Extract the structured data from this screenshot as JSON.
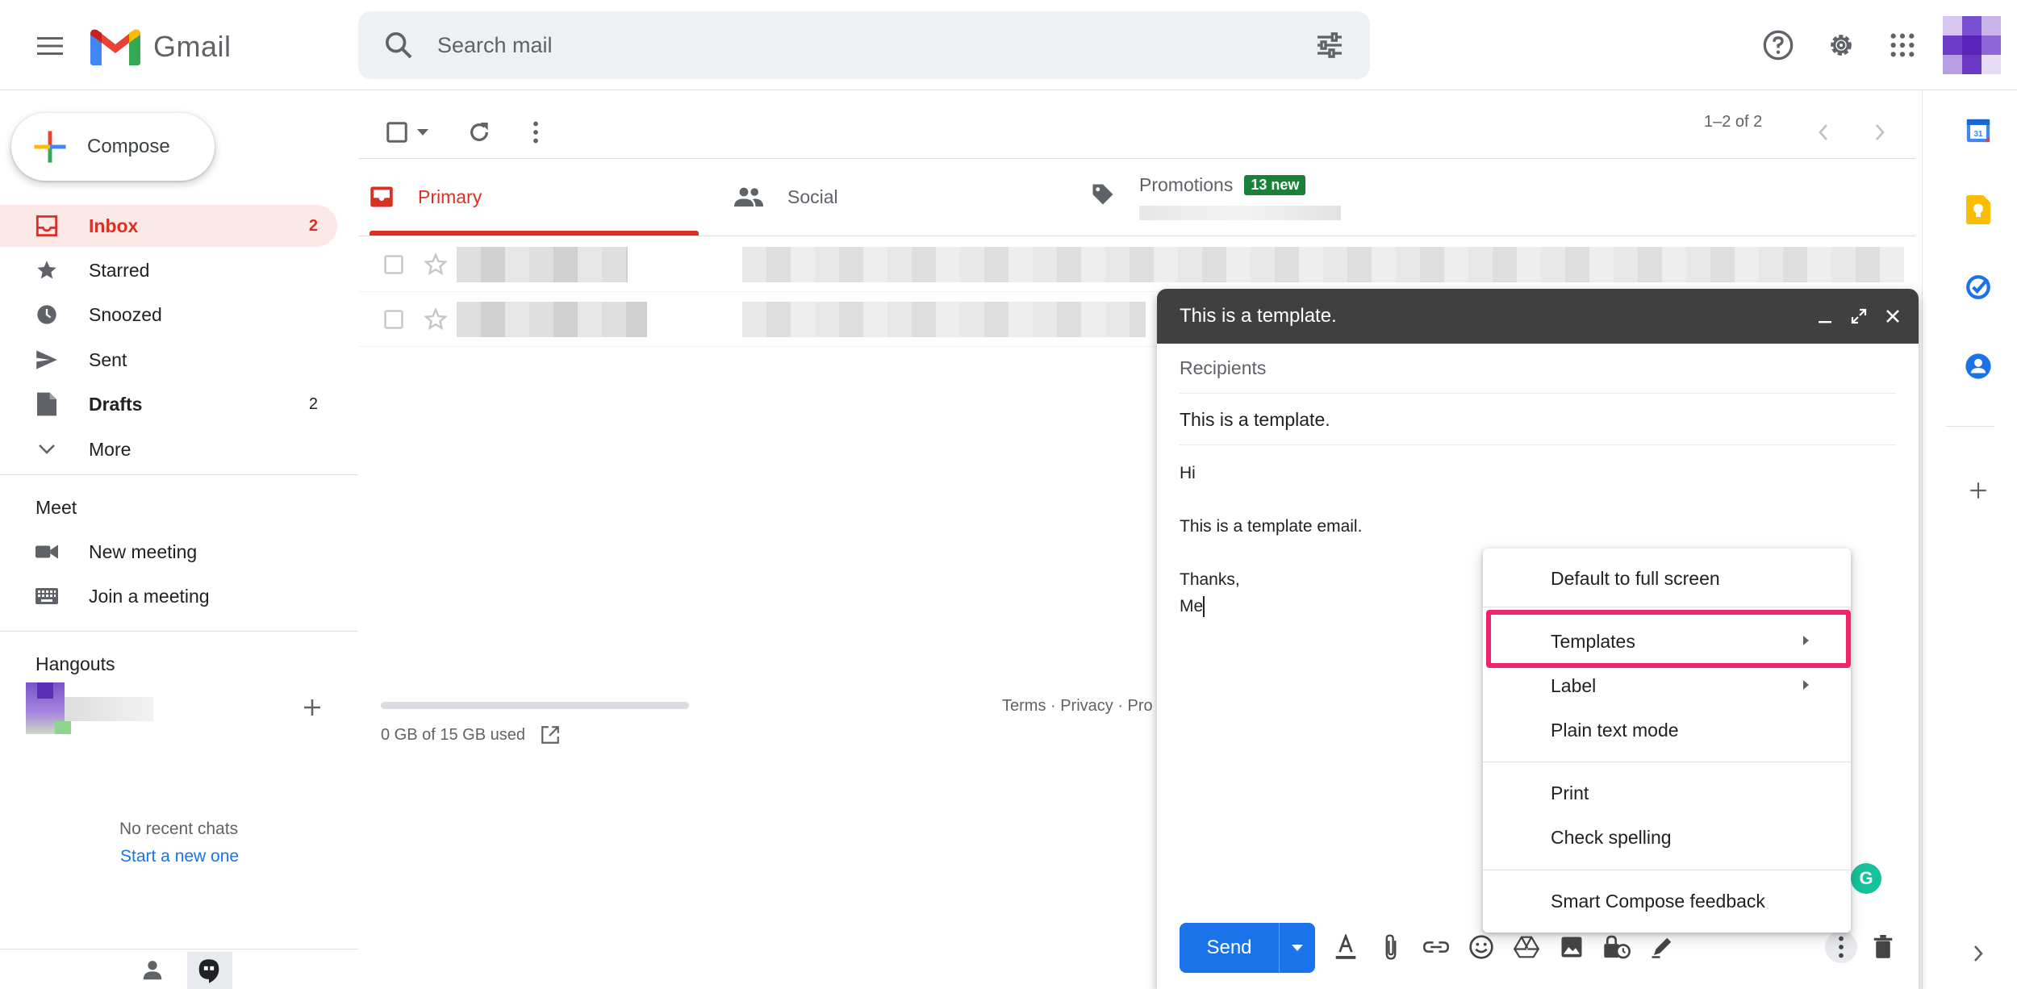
{
  "header": {
    "app_name": "Gmail",
    "search_placeholder": "Search mail"
  },
  "sidebar": {
    "compose_label": "Compose",
    "items": [
      {
        "label": "Inbox",
        "count": "2"
      },
      {
        "label": "Starred",
        "count": ""
      },
      {
        "label": "Snoozed",
        "count": ""
      },
      {
        "label": "Sent",
        "count": ""
      },
      {
        "label": "Drafts",
        "count": "2"
      },
      {
        "label": "More",
        "count": ""
      }
    ],
    "meet": {
      "title": "Meet",
      "items": [
        "New meeting",
        "Join a meeting"
      ]
    },
    "hangouts": {
      "title": "Hangouts",
      "no_chats": "No recent chats",
      "start_link": "Start a new one"
    }
  },
  "toolbar": {
    "pager": "1–2 of 2"
  },
  "tabs": [
    {
      "label": "Primary"
    },
    {
      "label": "Social"
    },
    {
      "label": "Promotions",
      "badge": "13 new"
    }
  ],
  "footer": {
    "storage": "0 GB of 15 GB used",
    "terms": "Terms · Privacy · Pro"
  },
  "compose_window": {
    "title": "This is a template.",
    "recipients_placeholder": "Recipients",
    "subject": "This is a template.",
    "body_lines": [
      "Hi",
      "This is a template email.",
      "Thanks,",
      "Me"
    ],
    "send_label": "Send"
  },
  "more_menu": {
    "items": [
      "Default to full screen",
      "Templates",
      "Label",
      "Plain text mode",
      "Print",
      "Check spelling",
      "Smart Compose feedback"
    ]
  },
  "colors": {
    "accent": "#d93025",
    "send": "#1a73e8",
    "highlight": "#f0246d",
    "badge": "#188038"
  }
}
